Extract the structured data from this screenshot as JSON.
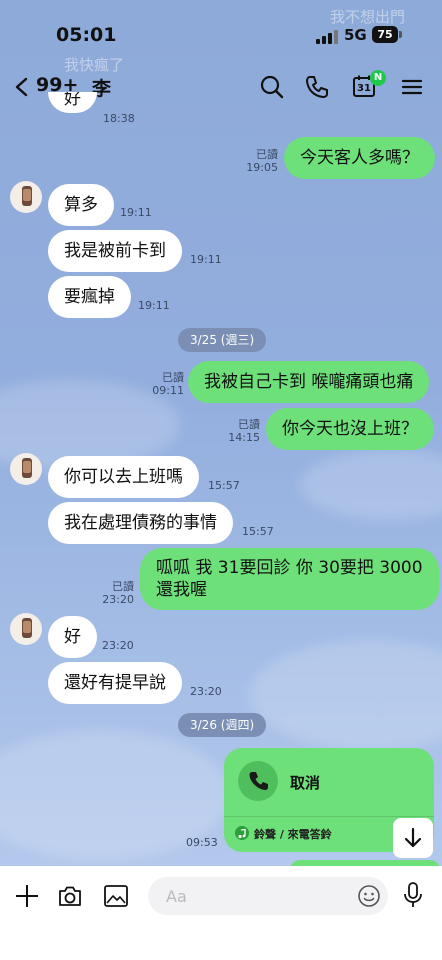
{
  "status": {
    "time": "05:01",
    "network": "5G",
    "battery": "75"
  },
  "ghost": {
    "top_right": "我不想出門",
    "top_left": "我快瘋了"
  },
  "header": {
    "back_count": "99+",
    "title": "李",
    "calendar_day": "31",
    "calendar_badge": "N"
  },
  "partial_top": {
    "text": "好",
    "time": "18:38"
  },
  "messages": [
    {
      "text": "今天客人多嗎？",
      "read": "已讀",
      "time": "19:05"
    },
    {
      "text": "算多",
      "time": "19:11"
    },
    {
      "text": "我是被前卡到",
      "time": "19:11"
    },
    {
      "text": "要瘋掉",
      "time": "19:11"
    },
    {
      "text": "我被自己卡到 喉嚨痛頭也痛",
      "read": "已讀",
      "time": "09:11"
    },
    {
      "text": "你今天也沒上班？",
      "read": "已讀",
      "time": "14:15"
    },
    {
      "text": "你可以去上班嗎",
      "time": "15:57"
    },
    {
      "text": "我在處理債務的事情",
      "time": "15:57"
    },
    {
      "line1": "呱呱 我 31要回診 你 30要把 3000",
      "line2": "還我喔",
      "read": "已讀",
      "time": "23:20"
    },
    {
      "text": "好",
      "time": "23:20"
    },
    {
      "text": "還好有提早說",
      "time": "23:20"
    }
  ],
  "dates": {
    "d1": "3/25 (週三)",
    "d2": "3/26 (週四)"
  },
  "call": {
    "label": "取消",
    "footer": "鈴聲 / 來電答鈴",
    "time": "09:53"
  },
  "input": {
    "placeholder": "Aa"
  },
  "colors": {
    "out_bubble": "#6ee07a",
    "in_bubble": "#ffffff",
    "chat_bg": "#93aede"
  }
}
